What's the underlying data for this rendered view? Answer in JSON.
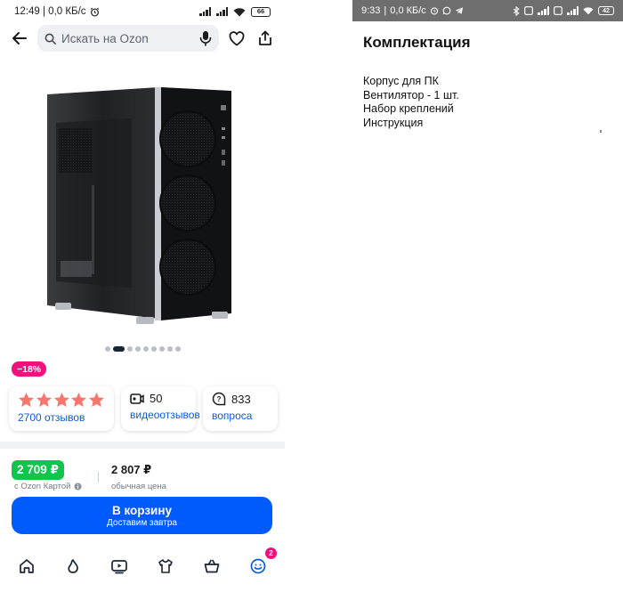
{
  "left": {
    "status": {
      "time": "12:49",
      "speed": "0,0 КБ/с",
      "battery": "66"
    },
    "search": {
      "placeholder": "Искать на Ozon"
    },
    "gallery": {
      "dots": 9,
      "active": 1
    },
    "discount": "−18%",
    "rating": {
      "stars": 5,
      "reviews_label": "2700 отзывов"
    },
    "video_reviews": {
      "count": "50",
      "label": "видеоотзывов"
    },
    "questions": {
      "count": "833",
      "label": "вопроса"
    },
    "price": {
      "card_price": "2 709 ₽",
      "card_label": "с Ozon Картой",
      "regular_price": "2 807 ₽",
      "regular_label": "обычная цена"
    },
    "cart_button": {
      "label": "В корзину",
      "sublabel": "Доставим завтра"
    },
    "nav": {
      "items": [
        "home-icon",
        "fresh-icon",
        "video-icon",
        "fashion-icon",
        "cart-icon",
        "profile-icon"
      ],
      "profile_badge": "2"
    },
    "colors": {
      "accent": "#005bff",
      "discount": "#f1117e",
      "green_price": "#10c44c",
      "stars": "#f8766d"
    }
  },
  "right": {
    "status": {
      "time": "9:33",
      "speed": "0,0 КБ/с",
      "battery": "42"
    },
    "title": "Комплектация",
    "items": [
      "Корпус для ПК",
      "Вентилятор - 1 шт.",
      "Набор креплений",
      "Инструкция"
    ]
  }
}
